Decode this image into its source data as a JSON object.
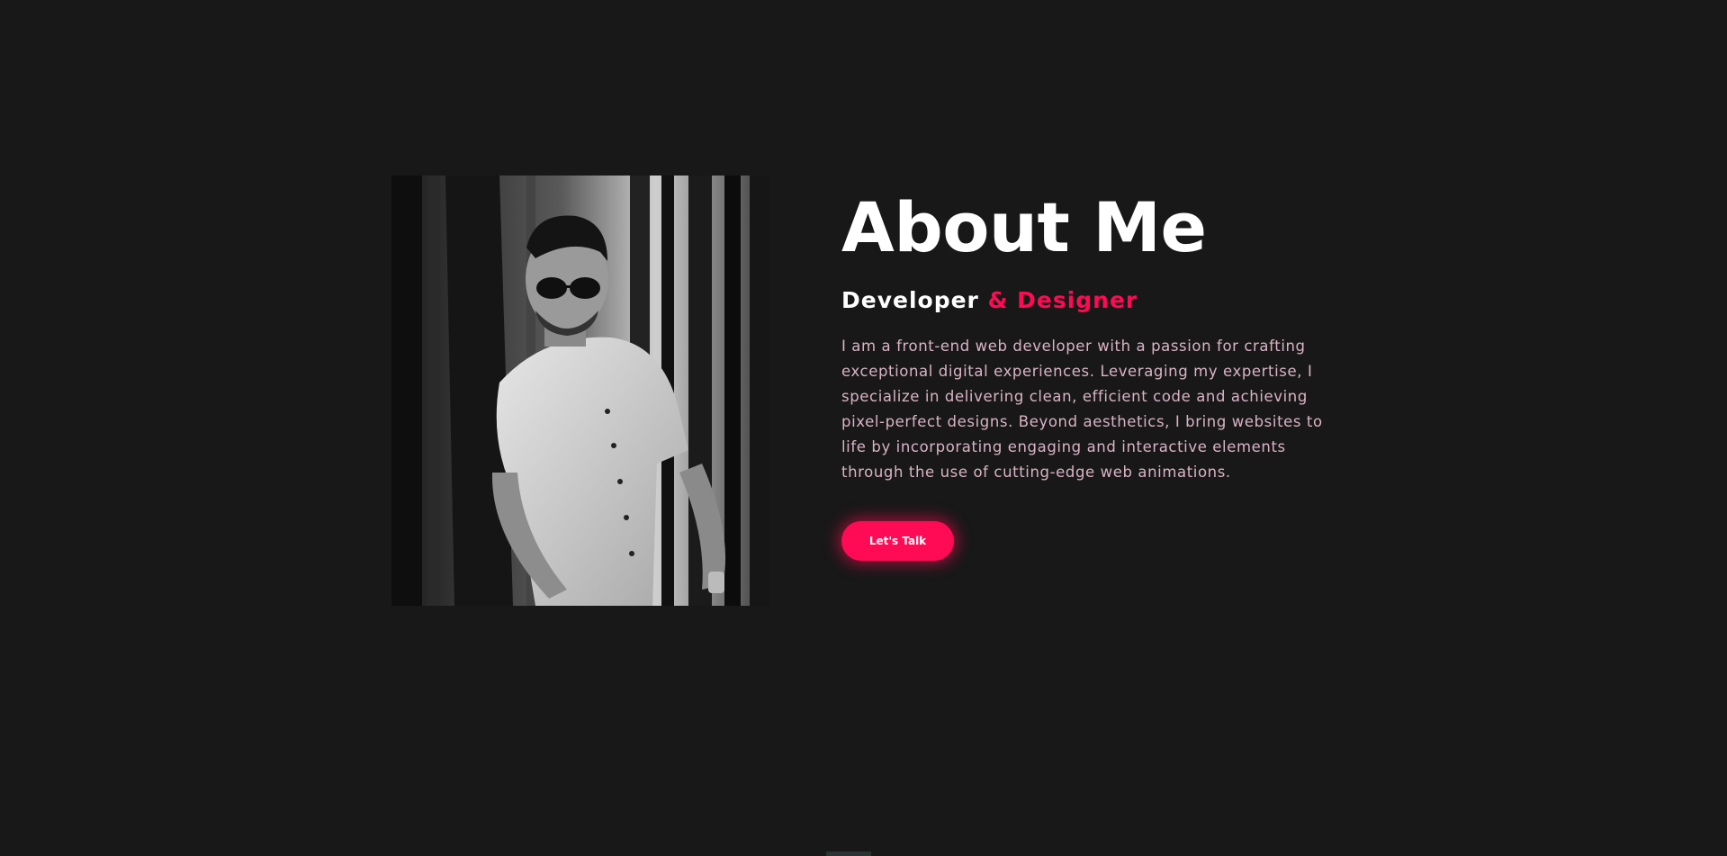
{
  "about": {
    "title": "About Me",
    "subtitle_primary": "Developer",
    "subtitle_accent": "& Designer",
    "bio": "I am a front-end web developer with a passion for crafting exceptional digital experiences. Leveraging my expertise, I specialize in delivering clean, efficient code and achieving pixel-perfect designs. Beyond aesthetics, I bring websites to life by incorporating engaging and interactive elements through the use of cutting-edge web animations.",
    "cta_label": "Let's Talk"
  },
  "colors": {
    "background": "#181818",
    "accent": "#ff0a54",
    "bio_text": "#d9b3c4",
    "heading": "#ffffff"
  }
}
